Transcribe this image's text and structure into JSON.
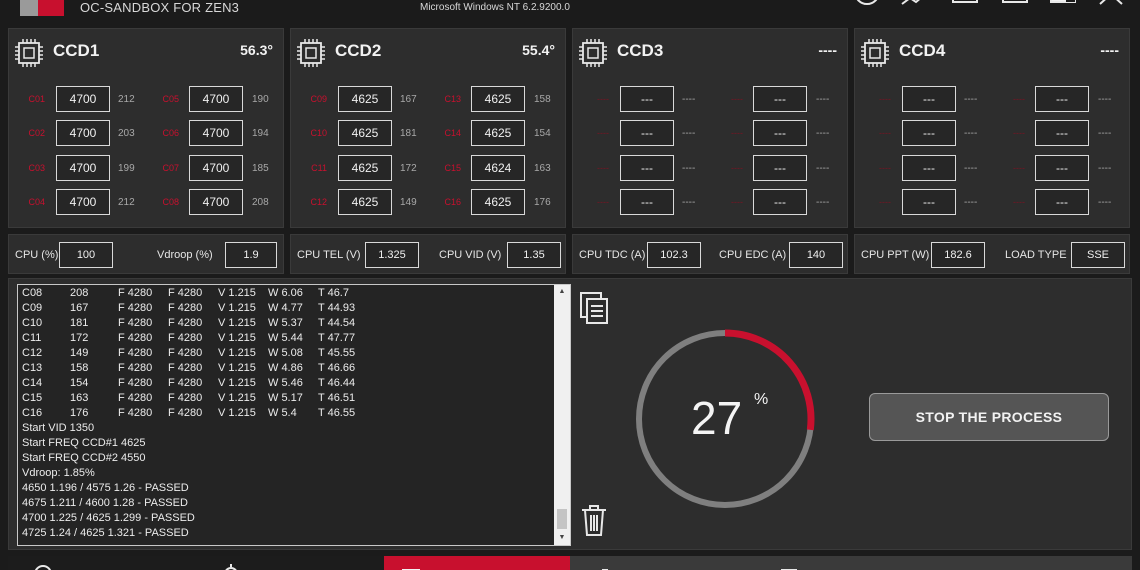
{
  "window": {
    "title": "OC-SANDBOX FOR ZEN3",
    "os_info": "Microsoft Windows NT 6.2.9200.0",
    "accent": "#c8102e"
  },
  "ccds": [
    {
      "name": "CCD1",
      "temp": "56.3°",
      "cores": [
        {
          "label": "C01",
          "freq": "4700",
          "value": "212"
        },
        {
          "label": "C05",
          "freq": "4700",
          "value": "190"
        },
        {
          "label": "C02",
          "freq": "4700",
          "value": "203"
        },
        {
          "label": "C06",
          "freq": "4700",
          "value": "194"
        },
        {
          "label": "C03",
          "freq": "4700",
          "value": "199"
        },
        {
          "label": "C07",
          "freq": "4700",
          "value": "185"
        },
        {
          "label": "C04",
          "freq": "4700",
          "value": "212"
        },
        {
          "label": "C08",
          "freq": "4700",
          "value": "208"
        }
      ]
    },
    {
      "name": "CCD2",
      "temp": "55.4°",
      "cores": [
        {
          "label": "C09",
          "freq": "4625",
          "value": "167"
        },
        {
          "label": "C13",
          "freq": "4625",
          "value": "158"
        },
        {
          "label": "C10",
          "freq": "4625",
          "value": "181"
        },
        {
          "label": "C14",
          "freq": "4625",
          "value": "154"
        },
        {
          "label": "C11",
          "freq": "4625",
          "value": "172"
        },
        {
          "label": "C15",
          "freq": "4624",
          "value": "163"
        },
        {
          "label": "C12",
          "freq": "4625",
          "value": "149"
        },
        {
          "label": "C16",
          "freq": "4625",
          "value": "176"
        }
      ]
    },
    {
      "name": "CCD3",
      "temp": "----",
      "cores": [
        {
          "label": "----",
          "freq": "---",
          "value": "----"
        },
        {
          "label": "----",
          "freq": "---",
          "value": "----"
        },
        {
          "label": "----",
          "freq": "---",
          "value": "----"
        },
        {
          "label": "----",
          "freq": "---",
          "value": "----"
        },
        {
          "label": "----",
          "freq": "---",
          "value": "----"
        },
        {
          "label": "----",
          "freq": "---",
          "value": "----"
        },
        {
          "label": "----",
          "freq": "---",
          "value": "----"
        },
        {
          "label": "----",
          "freq": "---",
          "value": "----"
        }
      ]
    },
    {
      "name": "CCD4",
      "temp": "----",
      "cores": [
        {
          "label": "----",
          "freq": "---",
          "value": "----"
        },
        {
          "label": "----",
          "freq": "---",
          "value": "----"
        },
        {
          "label": "----",
          "freq": "---",
          "value": "----"
        },
        {
          "label": "----",
          "freq": "---",
          "value": "----"
        },
        {
          "label": "----",
          "freq": "---",
          "value": "----"
        },
        {
          "label": "----",
          "freq": "---",
          "value": "----"
        },
        {
          "label": "----",
          "freq": "---",
          "value": "----"
        },
        {
          "label": "----",
          "freq": "---",
          "value": "----"
        }
      ]
    }
  ],
  "params": [
    {
      "label1": "CPU (%)",
      "value1": "100",
      "label2": "Vdroop (%)",
      "value2": "1.9"
    },
    {
      "label1": "CPU TEL (V)",
      "value1": "1.325",
      "label2": "CPU VID (V)",
      "value2": "1.35"
    },
    {
      "label1": "CPU TDC (A)",
      "value1": "102.3",
      "label2": "CPU EDC (A)",
      "value2": "140"
    },
    {
      "label1": "CPU PPT (W)",
      "value1": "182.6",
      "label2": "LOAD TYPE",
      "value2": "SSE"
    }
  ],
  "log": {
    "rows": [
      [
        "C08",
        "208",
        "F 4280",
        "F 4280",
        "V 1.215",
        "W 6.06",
        "T 46.7"
      ],
      [
        "C09",
        "167",
        "F 4280",
        "F 4280",
        "V 1.215",
        "W 4.77",
        "T 44.93"
      ],
      [
        "C10",
        "181",
        "F 4280",
        "F 4280",
        "V 1.215",
        "W 5.37",
        "T 44.54"
      ],
      [
        "C11",
        "172",
        "F 4280",
        "F 4280",
        "V 1.215",
        "W 5.44",
        "T 47.77"
      ],
      [
        "C12",
        "149",
        "F 4280",
        "F 4280",
        "V 1.215",
        "W 5.08",
        "T 45.55"
      ],
      [
        "C13",
        "158",
        "F 4280",
        "F 4280",
        "V 1.215",
        "W 4.86",
        "T 46.66"
      ],
      [
        "C14",
        "154",
        "F 4280",
        "F 4280",
        "V 1.215",
        "W 5.46",
        "T 46.44"
      ],
      [
        "C15",
        "163",
        "F 4280",
        "F 4280",
        "V 1.215",
        "W 5.17",
        "T 46.51"
      ],
      [
        "C16",
        "176",
        "F 4280",
        "F 4280",
        "V 1.215",
        "W 5.4",
        "T 46.55"
      ]
    ],
    "lines": [
      "Start VID 1350",
      "Start FREQ CCD#1 4625",
      "Start FREQ CCD#2 4550",
      "Vdroop: 1.85%",
      "4650 1.196 / 4575 1.26 - PASSED",
      "4675 1.211 / 4600 1.28 - PASSED",
      "4700 1.225 / 4625 1.299 - PASSED",
      "4725 1.24 / 4625 1.321 - PASSED"
    ]
  },
  "progress": {
    "value": "27",
    "unit": "%",
    "fraction": 0.27
  },
  "stop_button": {
    "label": "STOP THE PROCESS"
  },
  "icons": {
    "copy": "copy-icon",
    "trash": "trash-icon",
    "chip": "cpu-chip-icon"
  }
}
